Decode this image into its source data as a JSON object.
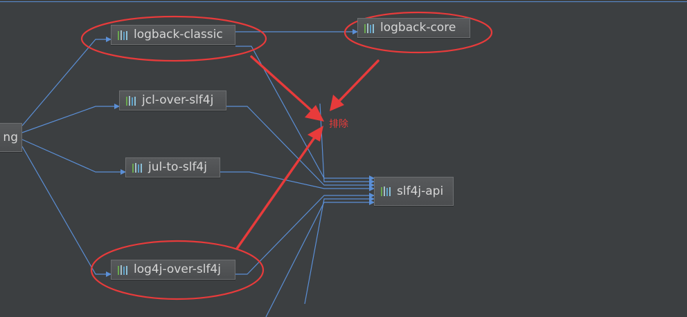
{
  "nodes": {
    "spring": "ng",
    "logback_classic": "logback-classic",
    "logback_core": "logback-core",
    "jcl_over_slf4j": "jcl-over-slf4j",
    "jul_to_slf4j": "jul-to-slf4j",
    "log4j_over_slf4j": "log4j-over-slf4j",
    "slf4j_api": "slf4j-api"
  },
  "annotation": {
    "exclude_label": "排除"
  },
  "colors": {
    "background": "#3c3f41",
    "edge": "#5b8fd6",
    "annotation": "#e83b3b",
    "node_text": "#d6d6d6"
  },
  "icons": {
    "library": "library-icon"
  }
}
